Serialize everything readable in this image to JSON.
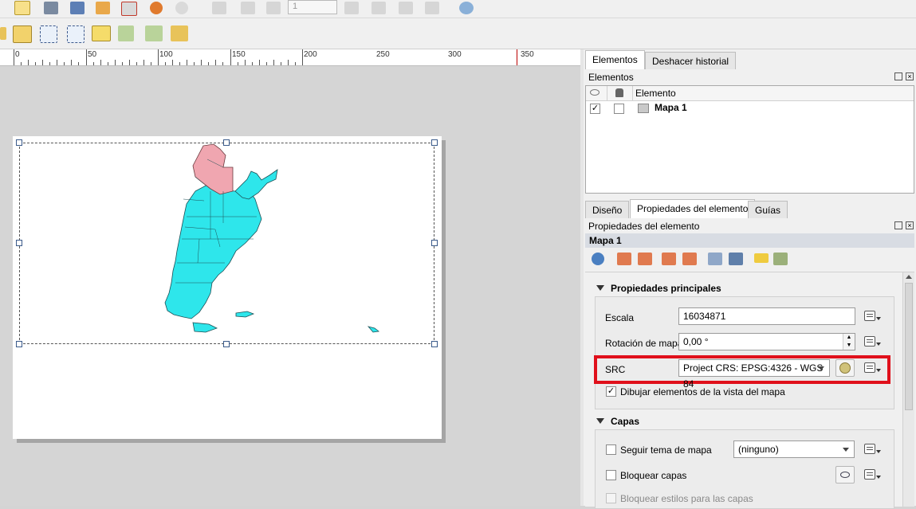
{
  "toolbar": {
    "page_number": "1"
  },
  "ruler": {
    "labels": [
      "0",
      "50",
      "100",
      "150",
      "200",
      "250",
      "300",
      "350"
    ]
  },
  "right_panel": {
    "top_tabs": [
      "Elementos",
      "Deshacer historial"
    ],
    "elements_title": "Elementos",
    "elements_header": "Elemento",
    "item_name": "Mapa 1",
    "bottom_tabs": [
      "Diseño",
      "Propiedades del elemento",
      "Guías"
    ],
    "props_title": "Propiedades del elemento",
    "item_header": "Mapa 1",
    "main_props": {
      "header": "Propiedades principales",
      "scale_label": "Escala",
      "scale_value": "16034871",
      "rotation_label": "Rotación de mapa",
      "rotation_value": "0,00 °",
      "src_label": "SRC",
      "src_value": "Project CRS: EPSG:4326 - WGS 84",
      "draw_label": "Dibujar elementos de la vista del mapa",
      "draw_checked": "✓"
    },
    "layers": {
      "header": "Capas",
      "follow_theme_label": "Seguir tema de mapa",
      "theme_value": "(ninguno)",
      "lock_layers_label": "Bloquear capas",
      "lock_styles_label": "Bloquear estilos para las capas"
    },
    "colors": {
      "highlight": "#e0101b",
      "map_fill": "#2ee6eb",
      "map_highlight": "#f0a6b0"
    }
  }
}
